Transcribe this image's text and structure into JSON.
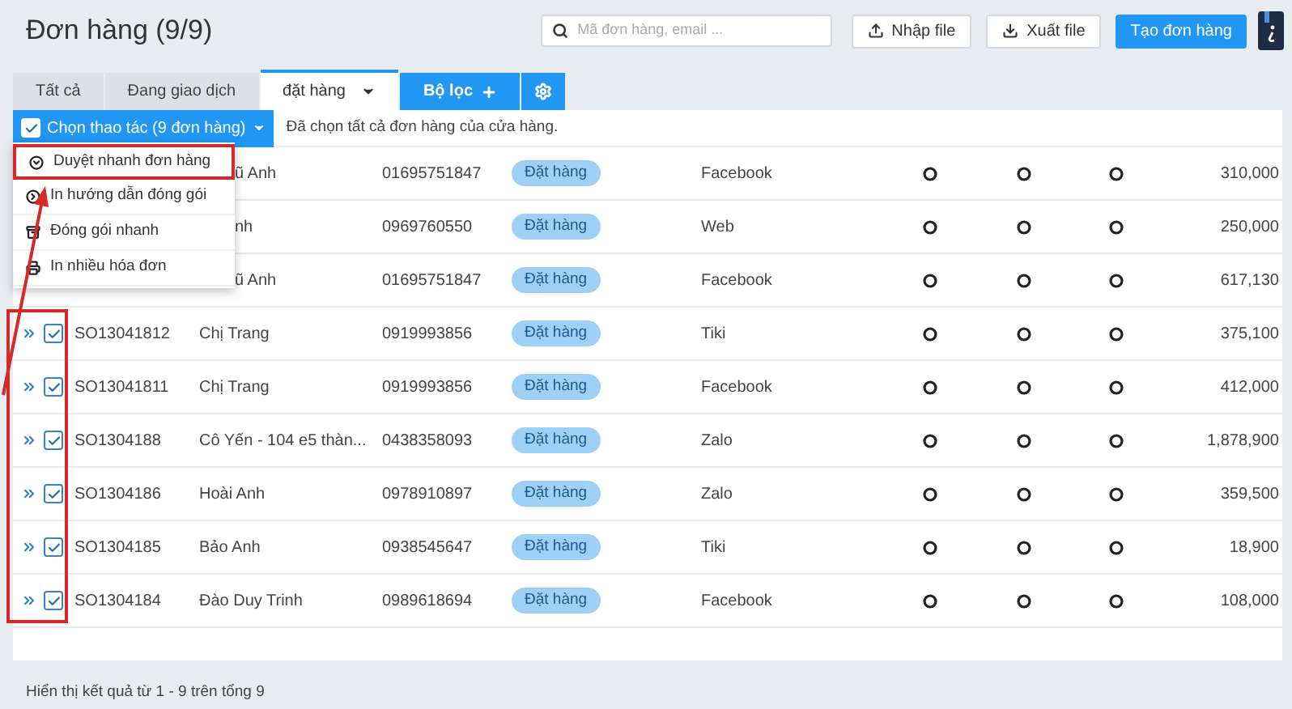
{
  "page": {
    "title": "Đơn hàng (9/9)"
  },
  "toolbar": {
    "search": {
      "placeholder": "Mã đơn hàng, email ..."
    },
    "buttons": [
      {
        "label": "Nhập file",
        "kind": "import"
      },
      {
        "label": "Xuất file",
        "kind": "export"
      },
      {
        "label": "Tạo đơn hàng",
        "kind": "primary"
      }
    ]
  },
  "tabs": [
    {
      "label": "Tất cả",
      "selected": false
    },
    {
      "label": "Đang giao dịch",
      "selected": false
    },
    {
      "label": "đặt hàng",
      "selected": true
    }
  ],
  "filter_button": {
    "label": "Bộ lọc"
  },
  "bulk_action": {
    "label": "Chọn thao tác (9 đơn hàng)",
    "checked": true,
    "note": "Đã chọn tất cả đơn hàng của cửa hàng."
  },
  "action_menu": [
    {
      "label": "Duyệt nhanh đơn hàng",
      "kind": "approve",
      "highlighted": true
    },
    {
      "label": "In hướng dẫn đóng gói",
      "kind": "guide",
      "highlighted": false
    },
    {
      "label": "Đóng gói nhanh",
      "kind": "pack",
      "highlighted": false
    },
    {
      "label": "In nhiều hóa đơn",
      "kind": "print",
      "highlighted": false
    }
  ],
  "rows": [
    {
      "customer": "ũ Anh",
      "phone": "01695751847",
      "status": "Đặt hàng",
      "source": "Facebook",
      "amount": "310,000"
    },
    {
      "customer": "nh",
      "phone": "0969760550",
      "status": "Đặt hàng",
      "source": "Web",
      "amount": "250,000"
    },
    {
      "customer": "ũ Anh",
      "phone": "01695751847",
      "status": "Đặt hàng",
      "source": "Facebook",
      "amount": "617,130"
    },
    {
      "code": "SO13041812",
      "customer": "Chị Trang",
      "phone": "0919993856",
      "status": "Đặt hàng",
      "source": "Tiki",
      "amount": "375,100",
      "checked": true
    },
    {
      "code": "SO13041811",
      "customer": "Chị Trang",
      "phone": "0919993856",
      "status": "Đặt hàng",
      "source": "Facebook",
      "amount": "412,000",
      "checked": true
    },
    {
      "code": "SO1304188",
      "customer": "Cô Yến - 104 e5 thàn...",
      "phone": "0438358093",
      "status": "Đặt hàng",
      "source": "Zalo",
      "amount": "1,878,900",
      "checked": true
    },
    {
      "code": "SO1304186",
      "customer": "Hoài Anh",
      "phone": "0978910897",
      "status": "Đặt hàng",
      "source": "Zalo",
      "amount": "359,500",
      "checked": true
    },
    {
      "code": "SO1304185",
      "customer": "Bảo Anh",
      "phone": "0938545647",
      "status": "Đặt hàng",
      "source": "Tiki",
      "amount": "18,900",
      "checked": true
    },
    {
      "code": "SO1304184",
      "customer": "Đào Duy Trinh",
      "phone": "0989618694",
      "status": "Đặt hàng",
      "source": "Facebook",
      "amount": "108,000",
      "checked": true
    }
  ],
  "footer": "Hiển thị kết quả từ 1 - 9 trên tổng 9"
}
